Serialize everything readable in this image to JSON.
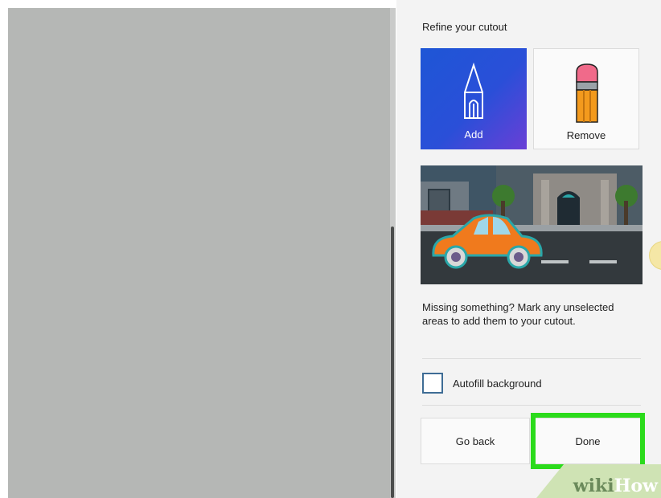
{
  "panel": {
    "title": "Refine your cutout",
    "tools": [
      {
        "label": "Add",
        "icon": "pen-icon",
        "selected": true
      },
      {
        "label": "Remove",
        "icon": "eraser-icon",
        "selected": false
      }
    ],
    "preview_icon": "car-street-illustration",
    "hint": "Missing something? Mark any unselected areas to add them to your cutout.",
    "autofill": {
      "label": "Autofill background",
      "checked": false
    },
    "buttons": {
      "back": "Go back",
      "done": "Done"
    }
  },
  "watermark": {
    "part1": "wiki",
    "part2": "How"
  },
  "colors": {
    "accent": "#1e56d6",
    "highlight": "#2bdb1b",
    "canvas": "#b5b7b5"
  }
}
